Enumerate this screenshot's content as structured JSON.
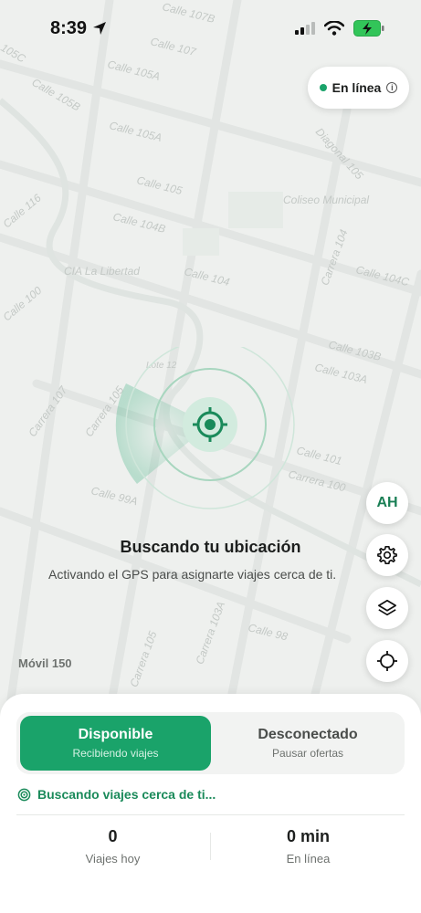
{
  "status_bar": {
    "time": "8:39"
  },
  "map": {
    "street_labels": [
      "Calle 107",
      "Calle 105A",
      "Calle 105B",
      "Calle 105A",
      "Calle 105",
      "Calle 104B",
      "Calle 104",
      "Carrera 104",
      "Calle 104C",
      "Calle 103B",
      "Calle 103A",
      "Calle 101",
      "Carrera 100",
      "Carrera 107",
      "Carrera 105",
      "Calle 99A",
      "Calle 98",
      "Diagonal 105",
      "Coliseo Municipal",
      "CIA La Libertad",
      "Calle 116",
      "Calle 100",
      "Lote 12",
      "Carrera 103A",
      "Carrera 105",
      "Calle 107B",
      "105C"
    ]
  },
  "online_pill": {
    "label": "En línea"
  },
  "radar": {
    "title": "Buscando tu ubicación",
    "subtitle": "Activando el GPS para asignarte viajes cerca de ti."
  },
  "vehicle": {
    "label": "Móvil 150"
  },
  "fabs": {
    "avatar_initials": "AH"
  },
  "sheet": {
    "available": {
      "title": "Disponible",
      "subtitle": "Recibiendo viajes"
    },
    "offline": {
      "title": "Desconectado",
      "subtitle": "Pausar ofertas"
    },
    "searching_text": "Buscando viajes cerca de ti...",
    "stats": [
      {
        "value": "0",
        "label": "Viajes hoy"
      },
      {
        "value": "0 min",
        "label": "En línea"
      }
    ]
  },
  "colors": {
    "accent": "#1aa36a",
    "accent_text": "#1a8a5a"
  }
}
